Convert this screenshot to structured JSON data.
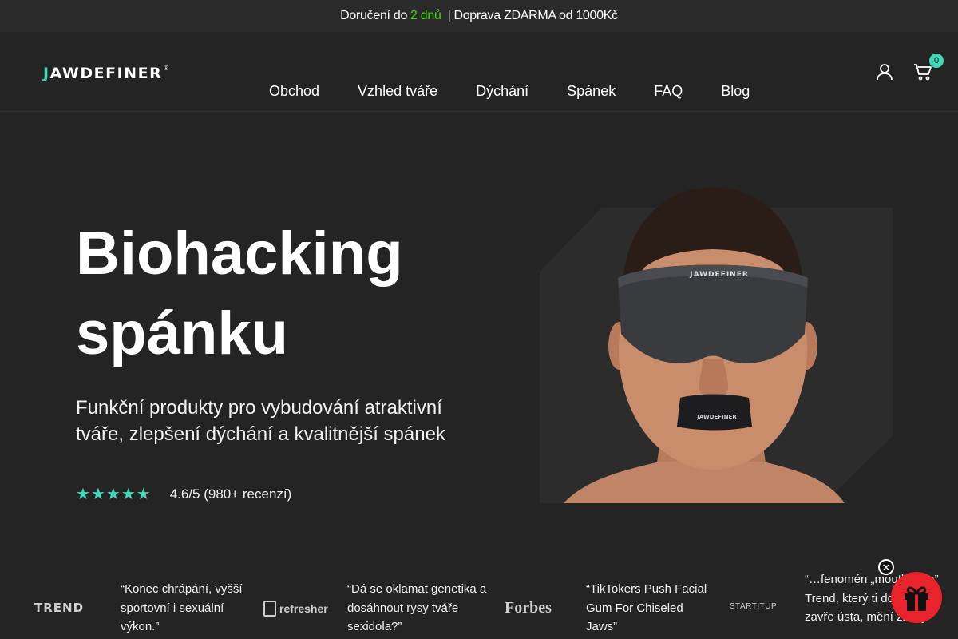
{
  "announcement": {
    "part1": "Doručení do",
    "highlight": "2 dnů",
    "separator": "|",
    "part2": "Doprava ZDARMA od 1000Kč"
  },
  "logo": {
    "first": "J",
    "rest": "AWDEFINER",
    "reg": "®"
  },
  "nav": {
    "items": [
      "Obchod",
      "Vzhled tváře",
      "Dýchání",
      "Spánek",
      "FAQ",
      "Blog"
    ]
  },
  "header_icons": {
    "account": "user-icon",
    "cart": "cart-icon",
    "cart_count": "0"
  },
  "hero": {
    "title_line1": "Biohacking",
    "title_line2": "spánku",
    "subtitle": "Funkční produkty pro vybudování atraktivní tváře, zlepšení dýchání a kvalitnější spánek",
    "rating_value": 4.6,
    "rating_text": "4.6/5 (980+ recenzí)",
    "image_mask_label": "JAWDEFINER",
    "image_tape_label": "JAWDEFINER"
  },
  "press": [
    {
      "logo": "TREND",
      "quote": "“Konec chrápání, vyšší sportovní i sexuální výkon.”"
    },
    {
      "logo": "refresher",
      "quote": "“Dá se oklamat genetika a dosáhnout rysy tváře sexidola?”"
    },
    {
      "logo": "Forbes",
      "quote": "“TikTokers Push Facial Gum For Chiseled Jaws”"
    },
    {
      "logo": "STARTITUP",
      "quote": "“…fenomén „mouth tape” Trend, který ti doslova zavře ústa, mění životy”"
    }
  ],
  "widgets": {
    "close_label": "✕",
    "gift_icon": "gift-icon"
  },
  "colors": {
    "accent": "#40d9b8",
    "background": "#242424",
    "highlight": "#46d60d",
    "gift": "#e8232c"
  }
}
